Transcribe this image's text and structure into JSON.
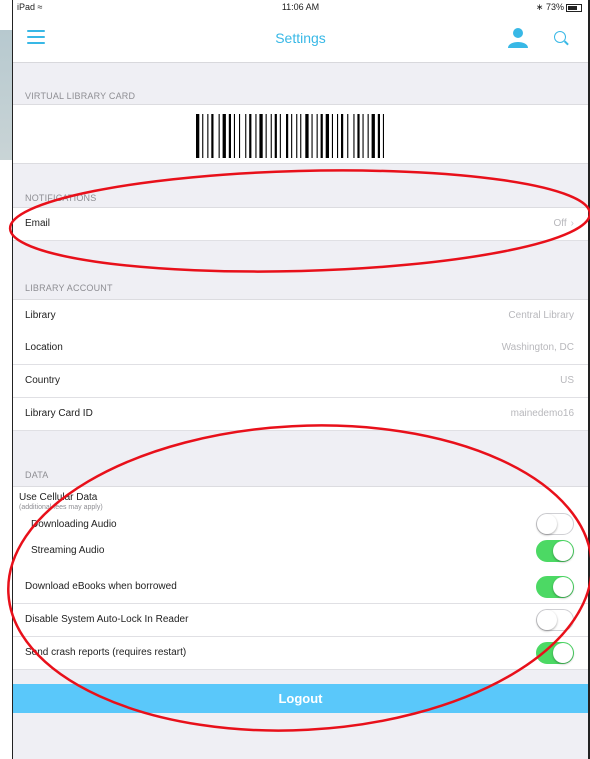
{
  "status_bar": {
    "device": "iPad",
    "time": "11:06 AM",
    "battery": "73%"
  },
  "nav": {
    "title": "Settings"
  },
  "sections": {
    "card": "VIRTUAL LIBRARY CARD",
    "notifications": "NOTIFICATIONS",
    "account": "LIBRARY ACCOUNT",
    "data": "DATA"
  },
  "notifications": {
    "email_label": "Email",
    "email_value": "Off"
  },
  "account": [
    {
      "label": "Library",
      "value": "Central Library"
    },
    {
      "label": "Location",
      "value": "Washington, DC"
    },
    {
      "label": "Country",
      "value": "US"
    },
    {
      "label": "Library Card ID",
      "value": "mainedemo16"
    }
  ],
  "data": {
    "cellular_title": "Use Cellular Data",
    "cellular_note": "(additional fees may apply)",
    "downloading_audio": {
      "label": "Downloading Audio",
      "on": false
    },
    "streaming_audio": {
      "label": "Streaming Audio",
      "on": true
    },
    "download_ebooks": {
      "label": "Download eBooks when borrowed",
      "on": true
    },
    "auto_lock": {
      "label": "Disable System Auto-Lock In Reader",
      "on": false
    },
    "crash_reports": {
      "label": "Send crash reports (requires restart)",
      "on": true
    }
  },
  "logout_label": "Logout",
  "colors": {
    "accent": "#38b8e6",
    "toggle_on": "#4cd964",
    "logout_bg": "#5ac8fa",
    "annotation": "#e8101a"
  }
}
